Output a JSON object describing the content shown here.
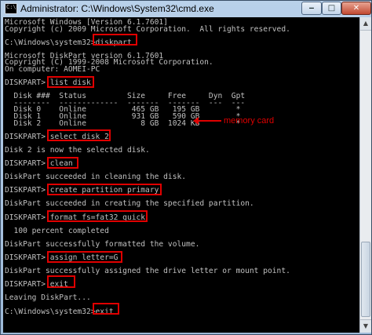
{
  "window": {
    "title": "Administrator: C:\\Windows\\System32\\cmd.exe",
    "minimize_glyph": "‒",
    "maximize_glyph": "□",
    "close_glyph": "✕"
  },
  "console_lines": [
    "Microsoft Windows [Version 6.1.7601]",
    "Copyright (c) 2009 Microsoft Corporation.  All rights reserved.",
    "",
    "C:\\Windows\\system32>diskpart",
    "",
    "Microsoft DiskPart version 6.1.7601",
    "Copyright (C) 1999-2008 Microsoft Corporation.",
    "On computer: AOMEI-PC",
    "",
    "DISKPART> list disk",
    "",
    "  Disk ###  Status         Size     Free     Dyn  Gpt",
    "  --------  -------------  -------  -------  ---  ---",
    "  Disk 0    Online          465 GB   195 GB        *",
    "  Disk 1    Online          931 GB   590 GB        *",
    "  Disk 2    Online            8 GB  1024 KB        *",
    "",
    "DISKPART> select disk 2",
    "",
    "Disk 2 is now the selected disk.",
    "",
    "DISKPART> clean",
    "",
    "DiskPart succeeded in cleaning the disk.",
    "",
    "DISKPART> create partition primary",
    "",
    "DiskPart succeeded in creating the specified partition.",
    "",
    "DISKPART> format fs=fat32 quick",
    "",
    "  100 percent completed",
    "",
    "DiskPart successfully formatted the volume.",
    "",
    "DISKPART> assign letter=G",
    "",
    "DiskPart successfully assigned the drive letter or mount point.",
    "",
    "DISKPART> exit",
    "",
    "Leaving DiskPart...",
    "",
    "C:\\Windows\\system32>exit"
  ],
  "annotation": {
    "label": "memory card",
    "color": "#e00000"
  },
  "scrollbar": {
    "up_glyph": "▲",
    "down_glyph": "▼"
  },
  "colors": {
    "console_bg": "#000000",
    "console_text": "#c0c0c0",
    "highlight": "#e00000"
  }
}
